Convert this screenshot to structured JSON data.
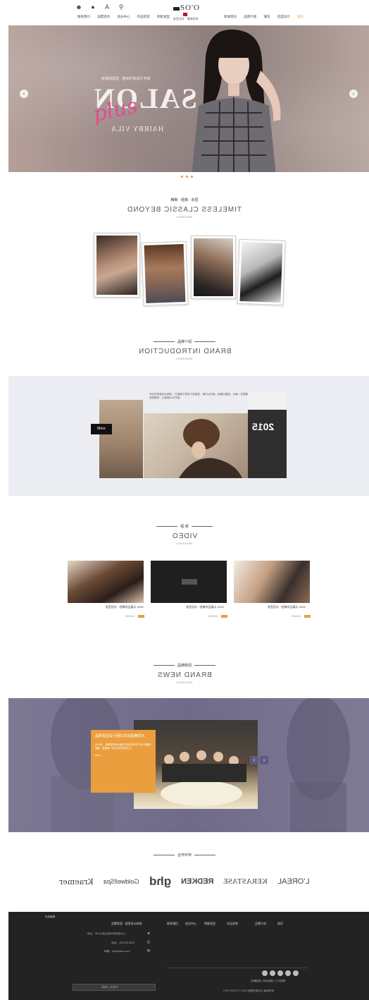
{
  "header": {
    "nav_left": [
      "联系我们",
      "加盟合作",
      "会员中心",
      "作品欣赏",
      "明星发型"
    ],
    "nav_right": [
      "新闻资讯",
      "品牌介绍",
      "潮流",
      "造型设计",
      "视频",
      "品牌经典",
      "首页"
    ],
    "logo_text": "SO'O",
    "logo_sub": "发型设计 · 潮流机构"
  },
  "hero": {
    "title": "SALON",
    "script": "plus",
    "subtitle": "HAIRBY VILA",
    "tag": "新潮流发型 · 整体形象设计专家"
  },
  "classic": {
    "small": "精致 · 经典 · 永恒",
    "big": "TIMELESS CLASSIC BEYOND",
    "tiny": "LEARN MORE"
  },
  "intro": {
    "small": "品牌介绍",
    "big": "BRAND INTRODUCTION",
    "tiny": "LEARN MORE",
    "text": "专业的发型设计团队，打造属于您的个性造型。我们以时尚、经典为理念，为每一位顾客提供贴心周到的服务，让美丽从头开始。",
    "more": "More",
    "year": "2015"
  },
  "video": {
    "small": "视 频",
    "big": "VIDEO",
    "tiny": "LEARN MORE",
    "items": [
      {
        "title": "发型设计 · 经典作品展示 2015",
        "meta": "2015-03"
      },
      {
        "title": "发型设计 · 经典作品展示 2015",
        "meta": "2015-03"
      },
      {
        "title": "发型设计 · 经典作品展示 2015",
        "meta": "2015-03"
      }
    ]
  },
  "news": {
    "small": "品牌新闻",
    "big": "BRAND NEWS",
    "tiny": "LEARN MORE",
    "card_title": "品牌发型设计团队年会圆满成功",
    "card_text": "2015年，品牌发型设计团队年会在欢乐的气氛中圆满落幕，感谢每一位伙伴的辛勤付出。",
    "card_more": "More"
  },
  "partners": {
    "small": "合作伙伴",
    "items": [
      "L'OREAL",
      "KERASTASE",
      "REDKEN",
      "ghd",
      "GoldwellSpa",
      "Kraemer"
    ]
  },
  "footer": {
    "cols": [
      "首页",
      "品牌介绍",
      "作品欣赏",
      "明星发型",
      "会员中心",
      "联系我们"
    ],
    "company": "品牌发型 · 造型设计机构",
    "address": "地址：市中心商业街88号发型中心",
    "phone": "电话：400-000-0000",
    "email": "邮箱：info@salon.com",
    "links": "友情链接 | 网站地图 | 人才招聘",
    "copyright": "COPYRIGHT © 2015 品牌发型设计 版权所有",
    "search_placeholder": "请输入关键字",
    "badge": "在线客服"
  }
}
